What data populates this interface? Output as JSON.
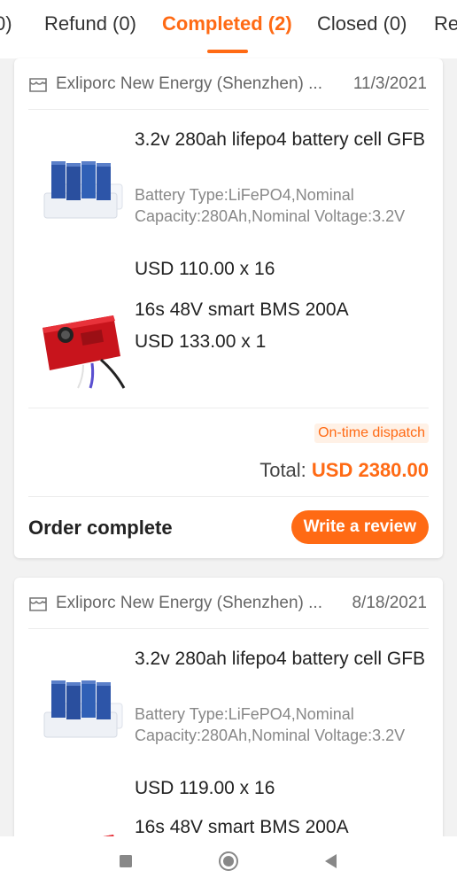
{
  "tabs": [
    {
      "label": "0)"
    },
    {
      "label": "Refund (0)"
    },
    {
      "label": "Completed (2)"
    },
    {
      "label": "Closed (0)"
    },
    {
      "label": "Re"
    }
  ],
  "active_tab": "Completed (2)",
  "orders": [
    {
      "store": "Exliporc New Energy (Shenzhen) ...",
      "date": "11/3/2021",
      "items": [
        {
          "title": " 3.2v 280ah lifepo4 battery cell GFB",
          "desc": "Battery Type:LiFePO4,Nominal Capacity:280Ah,Nominal Voltage:3.2V",
          "price": "USD 110.00 x 16"
        },
        {
          "title": "16s 48V smart BMS 200A",
          "price": "USD 133.00 x 1"
        }
      ],
      "badge": "On-time dispatch",
      "total_label": "Total: ",
      "total_value": "USD 2380.00",
      "status": "Order complete",
      "review_button": "Write a review"
    },
    {
      "store": "Exliporc New Energy (Shenzhen) ...",
      "date": "8/18/2021",
      "items": [
        {
          "title": " 3.2v 280ah lifepo4 battery cell GFB",
          "desc": "Battery Type:LiFePO4,Nominal Capacity:280Ah,Nominal Voltage:3.2V",
          "price": "USD 119.00 x 16"
        },
        {
          "title": "16s 48V smart BMS 200A"
        }
      ]
    }
  ],
  "navbar": {
    "icons": [
      "recents-square-icon",
      "home-circle-icon",
      "back-triangle-icon"
    ]
  },
  "colors": {
    "accent": "#ff6a14",
    "badge_bg": "#fff1e6"
  }
}
